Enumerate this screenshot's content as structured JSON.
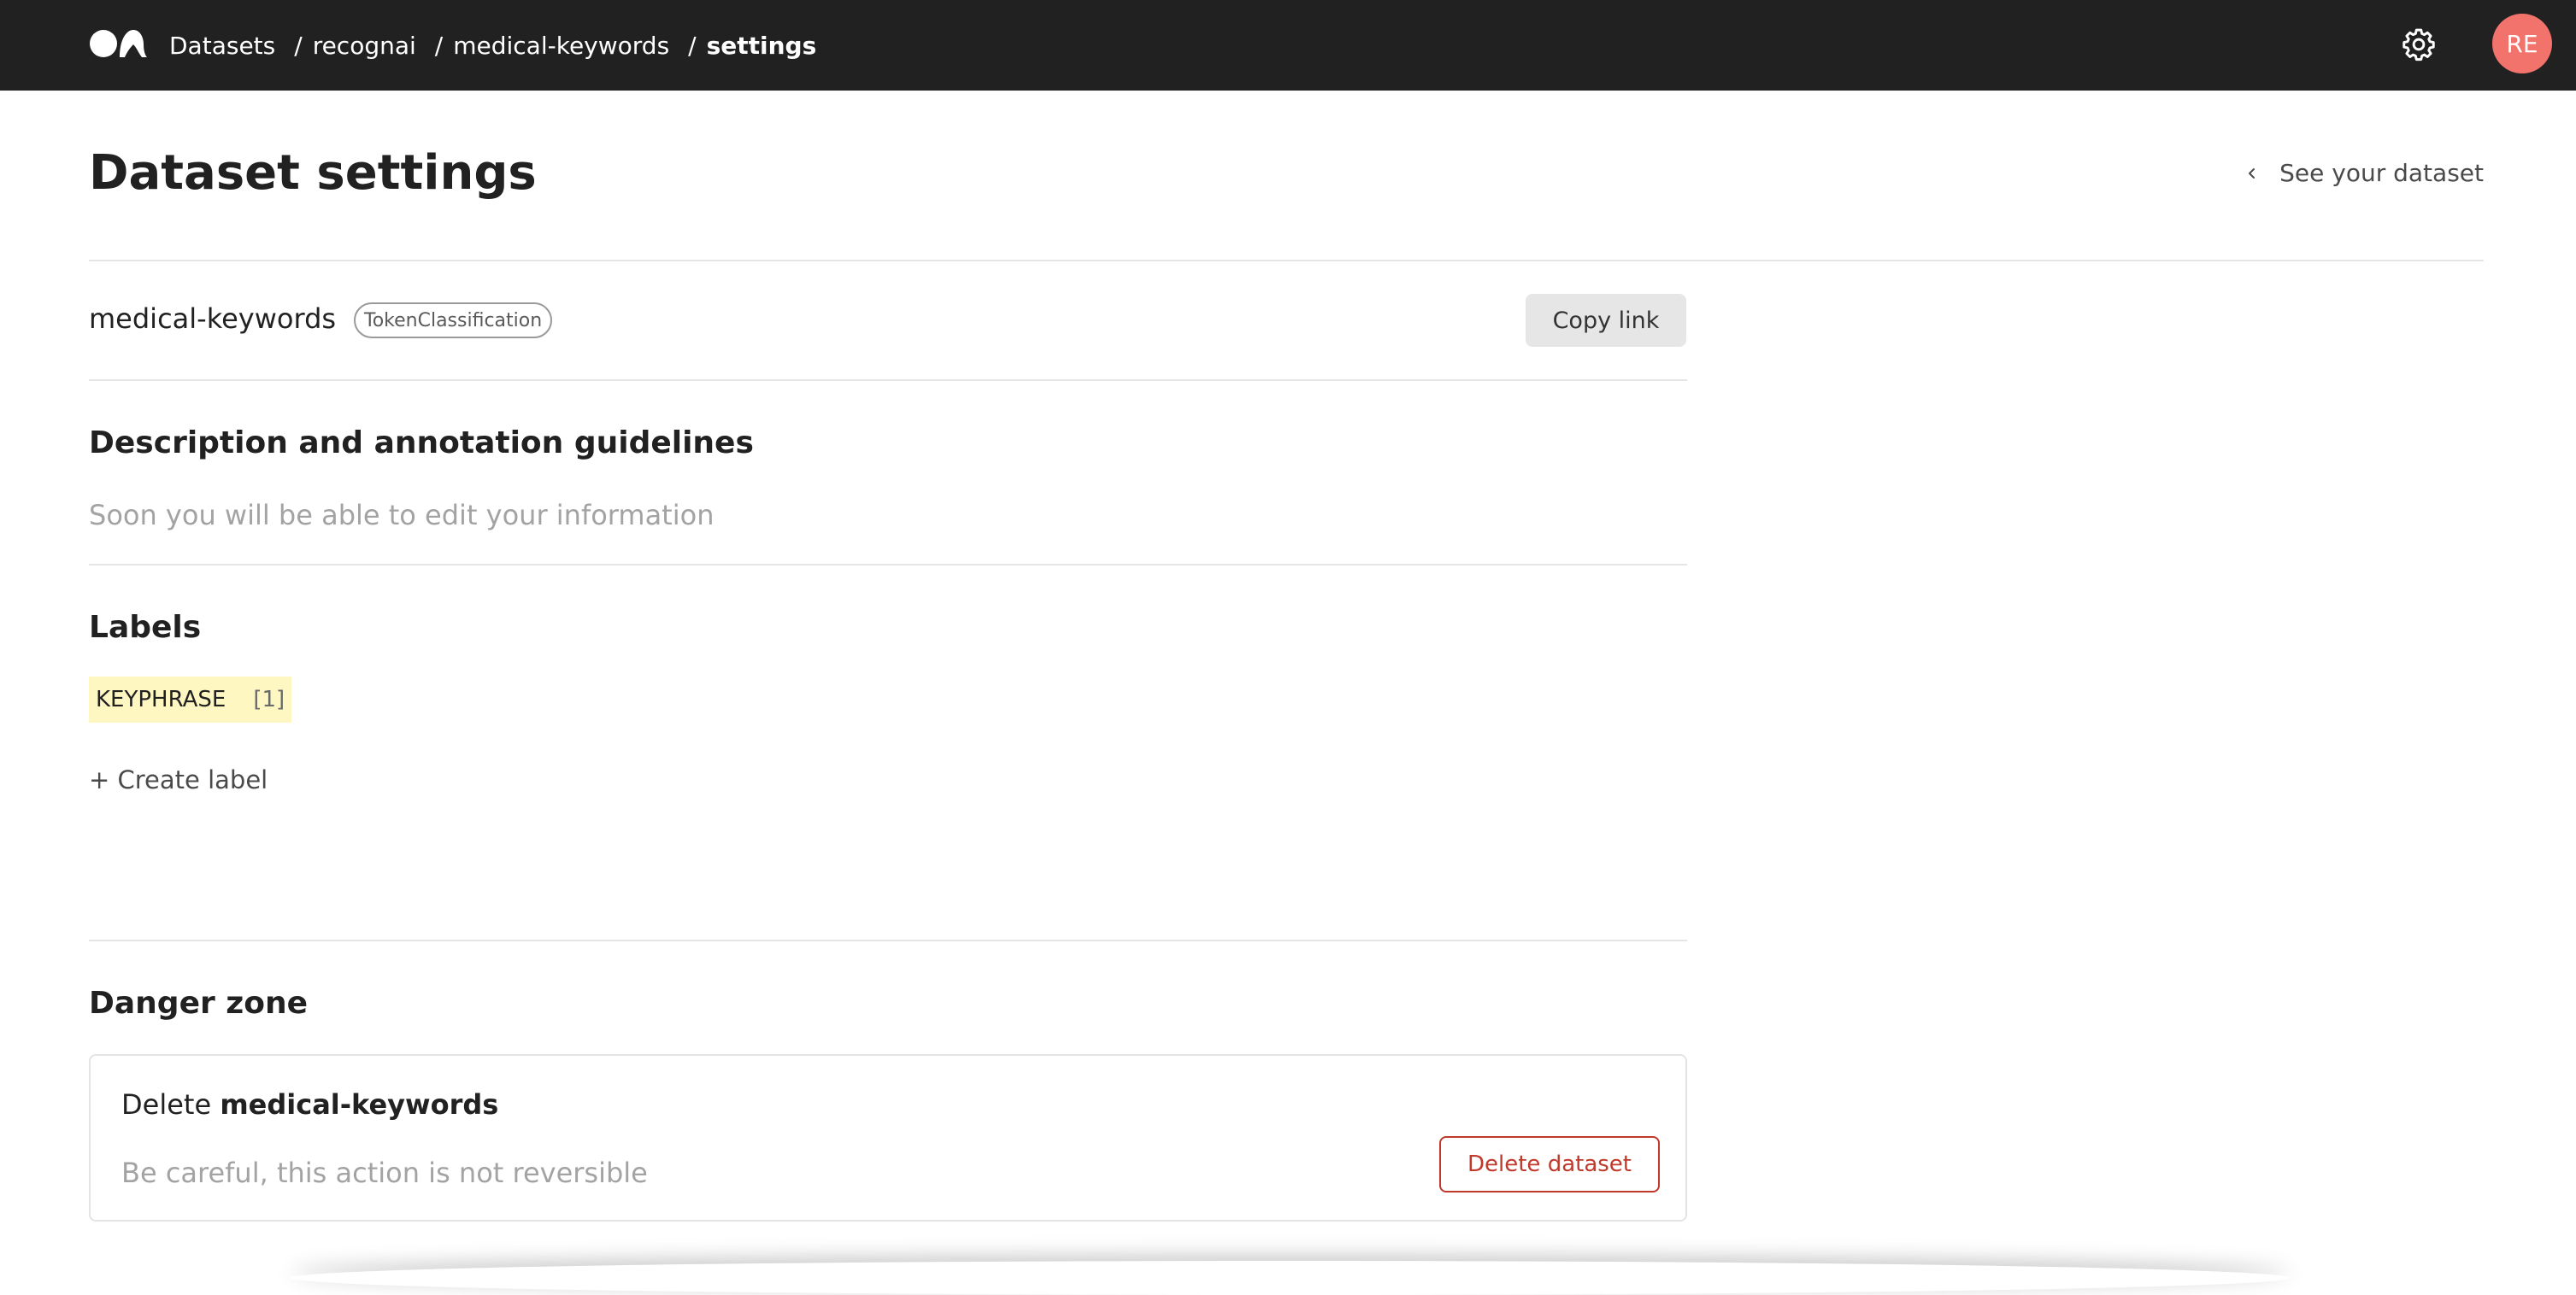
{
  "topbar": {
    "breadcrumbs": [
      "Datasets",
      "recognai",
      "medical-keywords"
    ],
    "current": "settings",
    "separator": "/",
    "avatar_initials": "RE",
    "avatar_color": "#f2736b",
    "background_color": "#212121"
  },
  "header": {
    "title": "Dataset settings",
    "back_link_label": "See your dataset"
  },
  "dataset": {
    "name": "medical-keywords",
    "task": "TokenClassification",
    "copy_link_label": "Copy link"
  },
  "description": {
    "title": "Description and annotation guidelines",
    "placeholder_text": "Soon you will be able to edit your information"
  },
  "labels": {
    "title": "Labels",
    "items": [
      {
        "name": "KEYPHRASE",
        "count": "[1]",
        "color": "#fff7c2"
      }
    ],
    "create_label": "+ Create label"
  },
  "danger_zone": {
    "title": "Danger zone",
    "delete_prefix": "Delete",
    "dataset_name": "medical-keywords",
    "warning": "Be careful, this action is not reversible",
    "delete_button_label": "Delete dataset",
    "accent_color": "#c0392b"
  }
}
